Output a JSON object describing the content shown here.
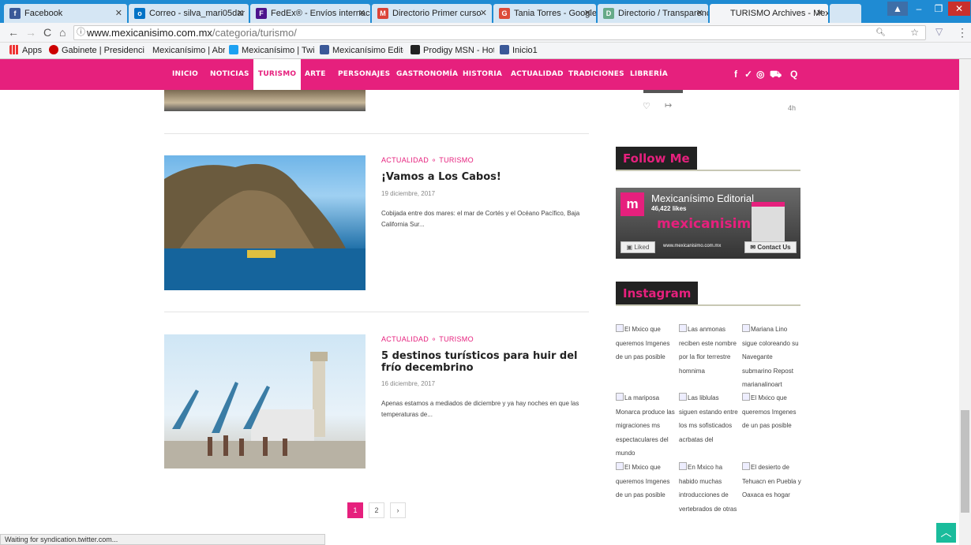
{
  "browser": {
    "tabs": [
      {
        "title": "Facebook",
        "fav": "f",
        "color": "#3b5998"
      },
      {
        "title": "Correo - silva_mari05dar",
        "fav": "o",
        "color": "#0072c6"
      },
      {
        "title": "FedEx® - Envíos internac",
        "fav": "F",
        "color": "#4d148c"
      },
      {
        "title": "Directorio Primer curso",
        "fav": "M",
        "color": "#db4437"
      },
      {
        "title": "Tania Torres - Google+",
        "fav": "G",
        "color": "#dd4b39"
      },
      {
        "title": "Directorio / Transparenci",
        "fav": "D",
        "color": "#6a8"
      },
      {
        "title": "TURISMO Archives - Mex",
        "fav": "",
        "color": "#fff"
      }
    ],
    "url_host": "www.mexicanisimo.com.mx",
    "url_path": "/categoria/turismo/",
    "bookmarks": [
      "Apps",
      "Gabinete | Presidenci",
      "Mexicanísimo | Abraz",
      "Mexicanísimo | Twitte",
      "Mexicanísimo Editoria",
      "Prodigy MSN - Hotm",
      "Inicio1"
    ],
    "status": "Waiting for syndication.twitter.com..."
  },
  "nav": {
    "items": [
      "INICIO",
      "NOTICIAS",
      "TURISMO",
      "ARTE",
      "PERSONAJES",
      "GASTRONOMÍA",
      "HISTORIA",
      "ACTUALIDAD",
      "TRADICIONES",
      "LIBRERÍA"
    ],
    "active": "TURISMO",
    "social": "f ✓ ◎ ♥ Q"
  },
  "posts": [
    {
      "cats": "ACTUALIDAD ⚬ TURISMO",
      "title": "¡Vamos a Los Cabos!",
      "date": "19 diciembre, 2017",
      "excerpt": "Cobijada entre dos mares: el mar de Cortés y el Océano Pacífico, Baja California Sur..."
    },
    {
      "cats": "ACTUALIDAD ⚬ TURISMO",
      "title": "5 destinos turísticos para huir del frío decembrino",
      "date": "16 diciembre, 2017",
      "excerpt": "Apenas estamos a mediados de diciembre y ya hay noches en que las temperaturas de..."
    }
  ],
  "sidebar": {
    "twitter_time": "4h",
    "follow_title": "Follow Me",
    "fb_name": "Mexicanísimo Editorial",
    "fb_likes": "46,422 likes",
    "fb_brand": "mexicanisimo",
    "fb_liked": "Liked",
    "fb_site": "www.mexicanisimo.com.mx",
    "fb_contact": "Contact Us",
    "instagram_title": "Instagram",
    "instagram": [
      "El Mxico que queremos Imgenes de un pas posible",
      "Las anmonas reciben este nombre por la flor terrestre homnima",
      "Mariana Lino sigue coloreando su Navegante submarino Repost marianalinoart",
      "La mariposa Monarca produce las migraciones ms espectaculares del mundo",
      "Las liblulas siguen estando entre los ms sofisticados acrbatas del",
      "El Mxico que queremos Imgenes de un pas posible",
      "El Mxico que queremos Imgenes de un pas posible",
      "En Mxico ha habido muchas introducciones de vertebrados de otras",
      "El desierto de Tehuacn en Puebla y Oaxaca es hogar"
    ]
  },
  "pagination": [
    "1",
    "2",
    "›"
  ]
}
